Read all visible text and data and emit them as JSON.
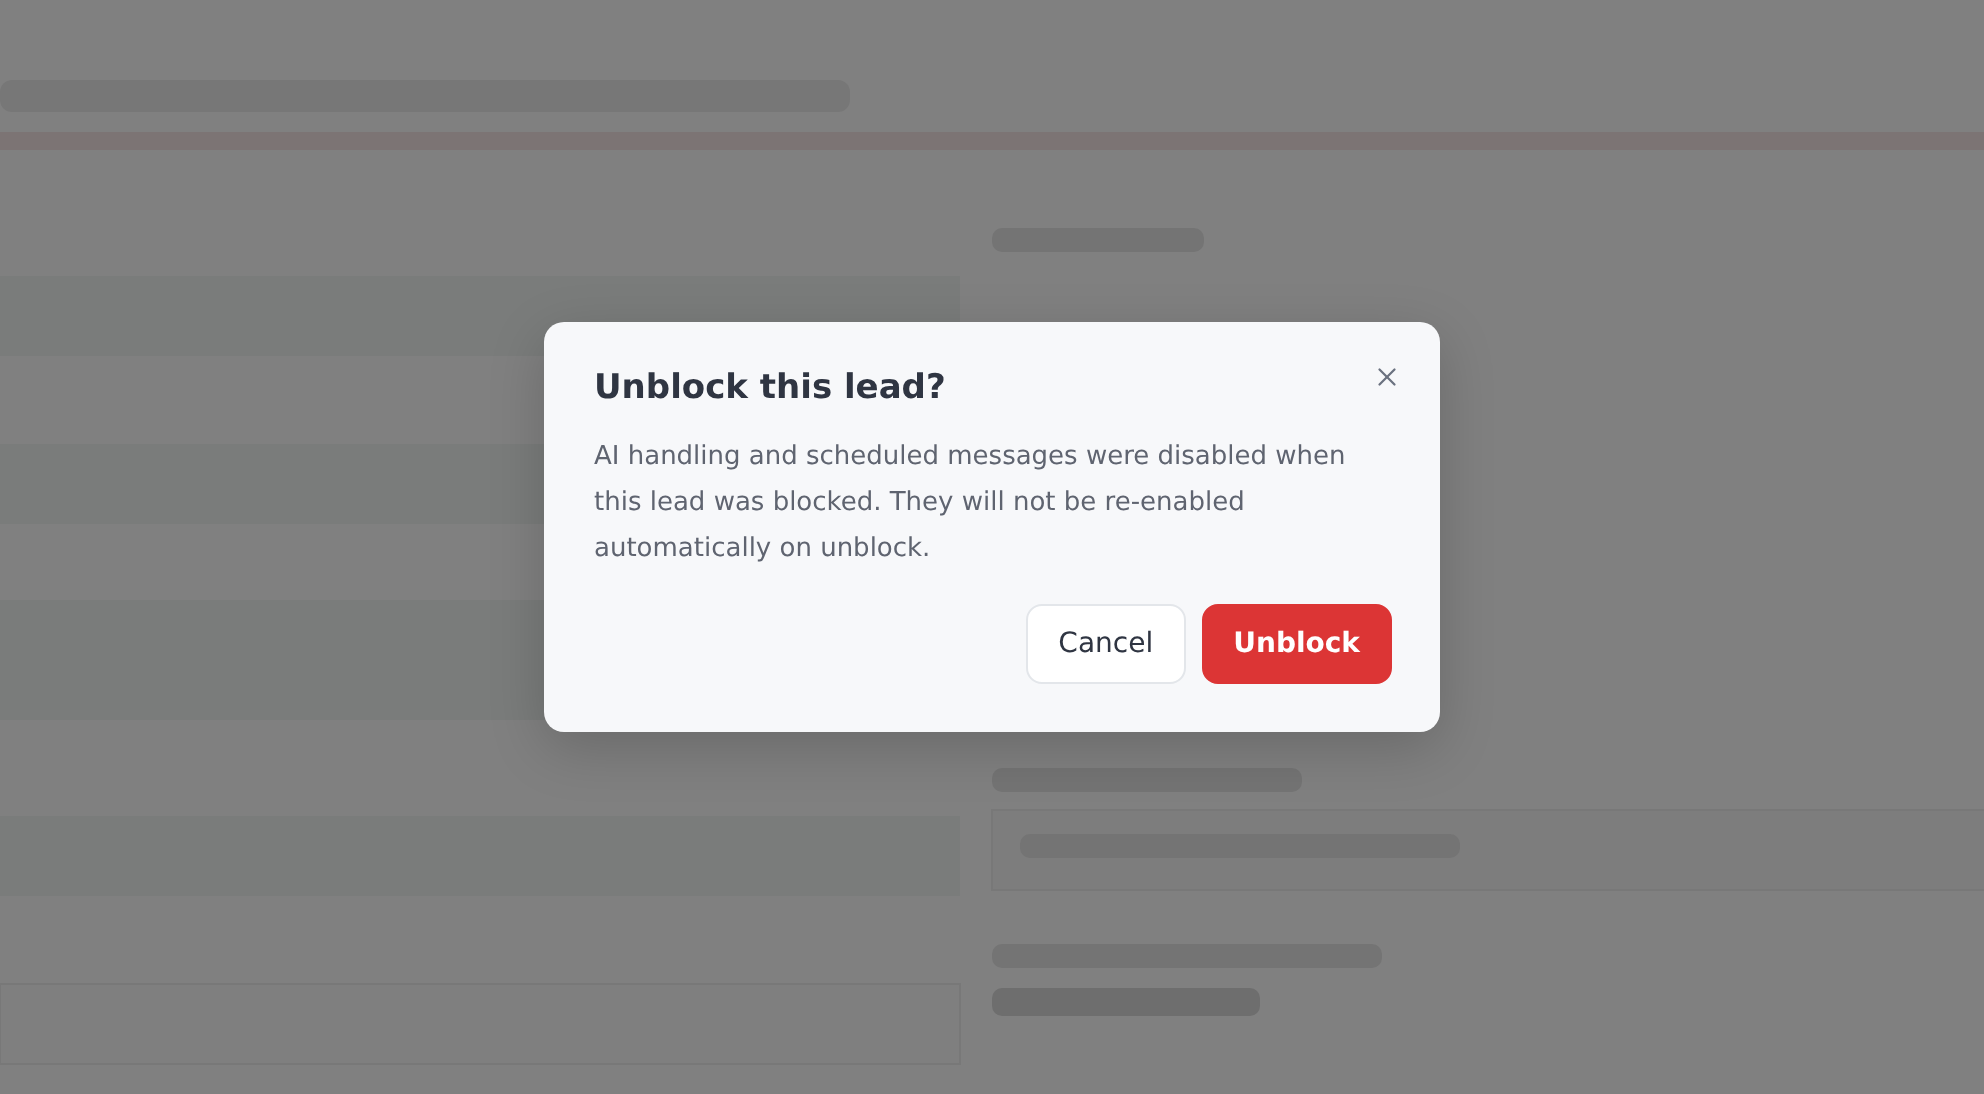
{
  "dialog": {
    "title": "Unblock this lead?",
    "body": "AI handling and scheduled messages were disabled when this lead was blocked. They will not be re-enabled automatically on unblock.",
    "buttons": [
      {
        "label": "Cancel",
        "kind": "secondary"
      },
      {
        "label": "Unblock",
        "kind": "danger"
      }
    ]
  }
}
